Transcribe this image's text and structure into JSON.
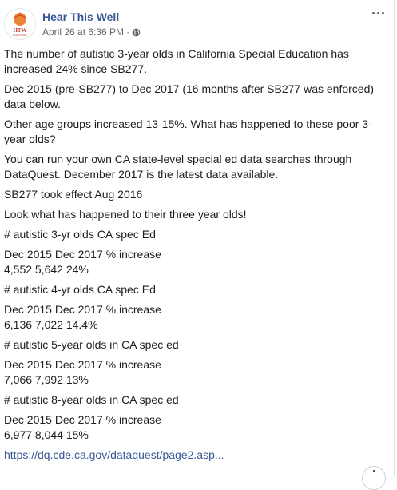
{
  "post": {
    "page_name": "Hear This Well",
    "timestamp": "April 26 at 6:36 PM",
    "separator": "·",
    "avatar_text": "HTW",
    "avatar_tagline": "Hear This Well",
    "brand_color": "#385898",
    "paragraphs": [
      "The number of autistic 3-year olds in California Special Education has increased 24% since SB277.",
      "Dec 2015 (pre-SB277) to Dec 2017 (16 months after SB277 was enforced) data below.",
      "Other age groups increased 13-15%. What has happened to these poor 3-year olds?",
      "You can run your own CA state-level special ed data searches through DataQuest. December 2017 is the latest data available.",
      "SB277 took effect Aug 2016",
      "Look what has happened to their three year olds!",
      "# autistic 3-yr olds CA spec Ed"
    ],
    "tables": [
      {
        "header": "Dec 2015 Dec 2017 % increase",
        "values": "4,552 5,642 24%",
        "next_title": "# autistic 4-yr olds CA spec Ed"
      },
      {
        "header": "Dec 2015 Dec 2017 % increase",
        "values": "6,136 7,022 14.4%",
        "next_title": "# autistic 5-year olds in CA spec ed"
      },
      {
        "header": "Dec 2015 Dec 2017 % increase",
        "values": "7,066 7,992 13%",
        "next_title": "# autistic 8-year olds in CA spec ed"
      },
      {
        "header": "Dec 2015 Dec 2017 % increase",
        "values": "6,977 8,044 15%"
      }
    ],
    "link": "https://dq.cde.ca.gov/dataquest/page2.asp..."
  },
  "icons": {
    "more": "more-options-icon",
    "audience": "globe-icon"
  }
}
